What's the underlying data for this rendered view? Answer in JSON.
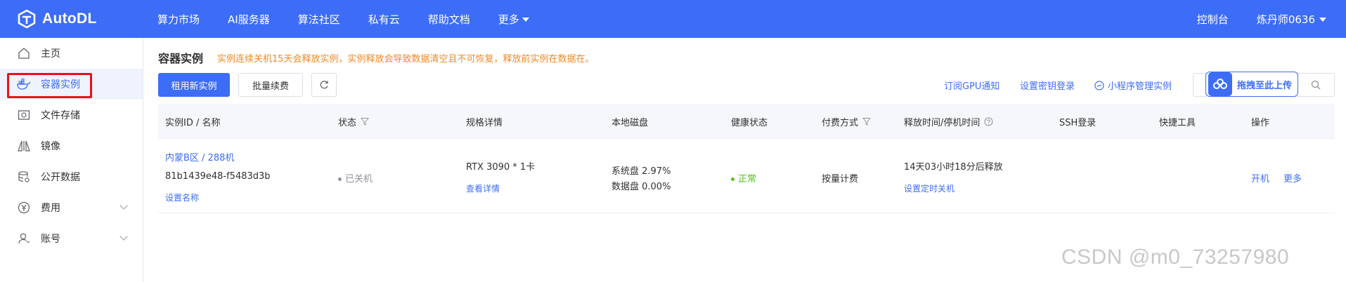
{
  "brand": {
    "name": "AutoDL"
  },
  "nav": {
    "items": [
      "算力市场",
      "AI服务器",
      "算法社区",
      "私有云",
      "帮助文档"
    ],
    "more": "更多"
  },
  "top_right": {
    "console": "控制台",
    "user": "炼丹师0636"
  },
  "sidebar": {
    "items": [
      {
        "label": "主页",
        "icon": "home-icon"
      },
      {
        "label": "容器实例",
        "icon": "container-icon"
      },
      {
        "label": "文件存储",
        "icon": "storage-icon"
      },
      {
        "label": "镜像",
        "icon": "image-icon"
      },
      {
        "label": "公开数据",
        "icon": "database-icon"
      },
      {
        "label": "费用",
        "icon": "yen-icon"
      },
      {
        "label": "账号",
        "icon": "user-icon"
      }
    ]
  },
  "page": {
    "title": "容器实例",
    "notice": "实例连续关机15天会释放实例，实例释放会导致数据清空且不可恢复，释放前实例在数据在。"
  },
  "toolbar": {
    "rent_button": "租用新实例",
    "batch_renew_button": "批量续费",
    "subscribe_gpu": "订阅GPU通知",
    "set_key_login": "设置密钥登录",
    "miniprogram_manage": "小程序管理实例",
    "upload_label": "拖拽至此上传"
  },
  "table": {
    "headers": [
      "实例ID / 名称",
      "状态",
      "规格详情",
      "本地磁盘",
      "健康状态",
      "付费方式",
      "释放时间/停机时间",
      "SSH登录",
      "快捷工具",
      "操作"
    ],
    "rows": [
      {
        "region": "内蒙B区 / 288机",
        "id": "81b1439e48-f5483d3b",
        "set_name": "设置名称",
        "status": "已关机",
        "spec": "RTX 3090 * 1卡",
        "spec_detail": "查看详情",
        "disk_system": "系统盘 2.97%",
        "disk_data": "数据盘 0.00%",
        "health": "正常",
        "billing": "按量计费",
        "release": "14天03小时18分后释放",
        "timed_shutdown": "设置定时关机",
        "action_start": "开机",
        "action_more": "更多"
      }
    ]
  },
  "watermark": "CSDN @m0_73257980",
  "colors": {
    "brand_blue": "#3d6df6",
    "notice_orange": "#f08a24",
    "ok_green": "#52c41a",
    "highlight_red": "#e8101d"
  }
}
